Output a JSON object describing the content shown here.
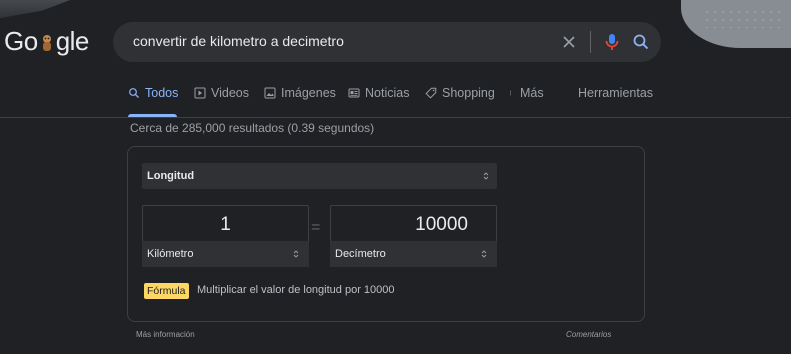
{
  "logo": {
    "text_before": "Go",
    "text_after": "gle"
  },
  "search": {
    "query": "convertir de kilometro a decimetro"
  },
  "tabs": [
    {
      "label": "Todos",
      "icon": "search-icon"
    },
    {
      "label": "Videos",
      "icon": "play-icon"
    },
    {
      "label": "Imágenes",
      "icon": "image-icon"
    },
    {
      "label": "Noticias",
      "icon": "news-icon"
    },
    {
      "label": "Shopping",
      "icon": "tag-icon"
    },
    {
      "label": "Más",
      "icon": "more-vert-icon"
    },
    {
      "label": "Herramientas",
      "icon": ""
    }
  ],
  "result_stats": "Cerca de 285,000 resultados (0.39 segundos)",
  "converter": {
    "category": "Longitud",
    "from": {
      "value": "1",
      "unit": "Kilómetro"
    },
    "to": {
      "value": "10000",
      "unit": "Decímetro"
    },
    "equals": "=",
    "formula_label": "Fórmula",
    "formula_text": "Multiplicar el valor de longitud por 10000"
  },
  "footer": {
    "more_info": "Más información",
    "comments": "Comentarios"
  },
  "colors": {
    "background": "#202124",
    "accent": "#8ab4f8",
    "formula_badge": "#fdd663",
    "mic_red": "#ea4335"
  }
}
